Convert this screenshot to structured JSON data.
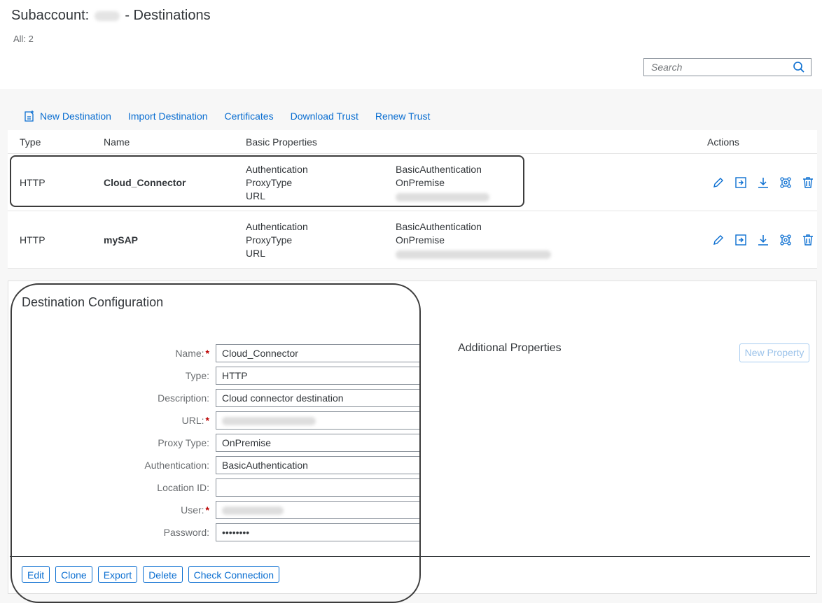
{
  "header": {
    "title_prefix": "Subaccount:",
    "title_suffix": "- Destinations",
    "count": "All: 2",
    "search_placeholder": "Search"
  },
  "toolbar": {
    "new_destination": "New Destination",
    "import_destination": "Import Destination",
    "certificates": "Certificates",
    "download_trust": "Download Trust",
    "renew_trust": "Renew Trust"
  },
  "table": {
    "columns": {
      "type": "Type",
      "name": "Name",
      "basic_properties": "Basic Properties",
      "actions": "Actions"
    },
    "rows": [
      {
        "type": "HTTP",
        "name": "Cloud_Connector",
        "props": [
          {
            "key": "Authentication",
            "value": "BasicAuthentication"
          },
          {
            "key": "ProxyType",
            "value": "OnPremise"
          },
          {
            "key": "URL",
            "value": ""
          }
        ]
      },
      {
        "type": "HTTP",
        "name": "mySAP",
        "props": [
          {
            "key": "Authentication",
            "value": "BasicAuthentication"
          },
          {
            "key": "ProxyType",
            "value": "OnPremise"
          },
          {
            "key": "URL",
            "value": ""
          }
        ]
      }
    ],
    "action_icons": [
      "edit-icon",
      "clone-icon",
      "download-icon",
      "check-connection-icon",
      "delete-icon"
    ]
  },
  "config": {
    "title": "Destination Configuration",
    "fields": [
      {
        "label": "Name:",
        "value": "Cloud_Connector",
        "required": true
      },
      {
        "label": "Type:",
        "value": "HTTP",
        "required": false
      },
      {
        "label": "Description:",
        "value": "Cloud connector destination",
        "required": false
      },
      {
        "label": "URL:",
        "value": "",
        "required": true
      },
      {
        "label": "Proxy Type:",
        "value": "OnPremise",
        "required": false
      },
      {
        "label": "Authentication:",
        "value": "BasicAuthentication",
        "required": false
      },
      {
        "label": "Location ID:",
        "value": "",
        "required": false
      },
      {
        "label": "User:",
        "value": "",
        "required": true
      },
      {
        "label": "Password:",
        "value": "••••••••",
        "required": false
      }
    ],
    "required_marker": "*",
    "additional_properties": "Additional Properties",
    "new_property": "New Property",
    "buttons": {
      "edit": "Edit",
      "clone": "Clone",
      "export": "Export",
      "delete": "Delete",
      "check_connection": "Check Connection"
    }
  },
  "colors": {
    "link": "#0a6ed1",
    "text": "#32363a",
    "required": "#bb0000",
    "background": "#f7f7f7"
  }
}
